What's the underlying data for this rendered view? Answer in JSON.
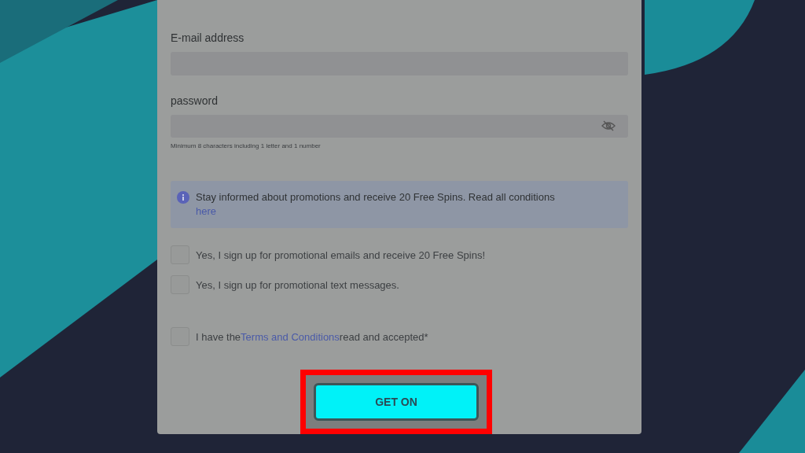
{
  "form": {
    "fields": [
      {
        "label": "E-mail address",
        "kind": "text"
      },
      {
        "label": "password",
        "kind": "password",
        "hint": "Minimum 8 characters including 1 letter and 1 number"
      }
    ],
    "info": {
      "text": "Stay informed about promotions and receive 20 Free Spins. Read all conditions",
      "link": "here"
    },
    "checkboxes": [
      {
        "label": "Yes, I sign up for promotional emails and receive 20 Free Spins!",
        "checked": false
      },
      {
        "label": "Yes, I sign up for promotional text messages.",
        "checked": false
      }
    ],
    "terms": {
      "before": "I have the",
      "link": "Terms and Conditions",
      "after": "read and accepted*",
      "checked": false
    },
    "submit": {
      "label": "GET ON",
      "highlighted": true
    }
  }
}
